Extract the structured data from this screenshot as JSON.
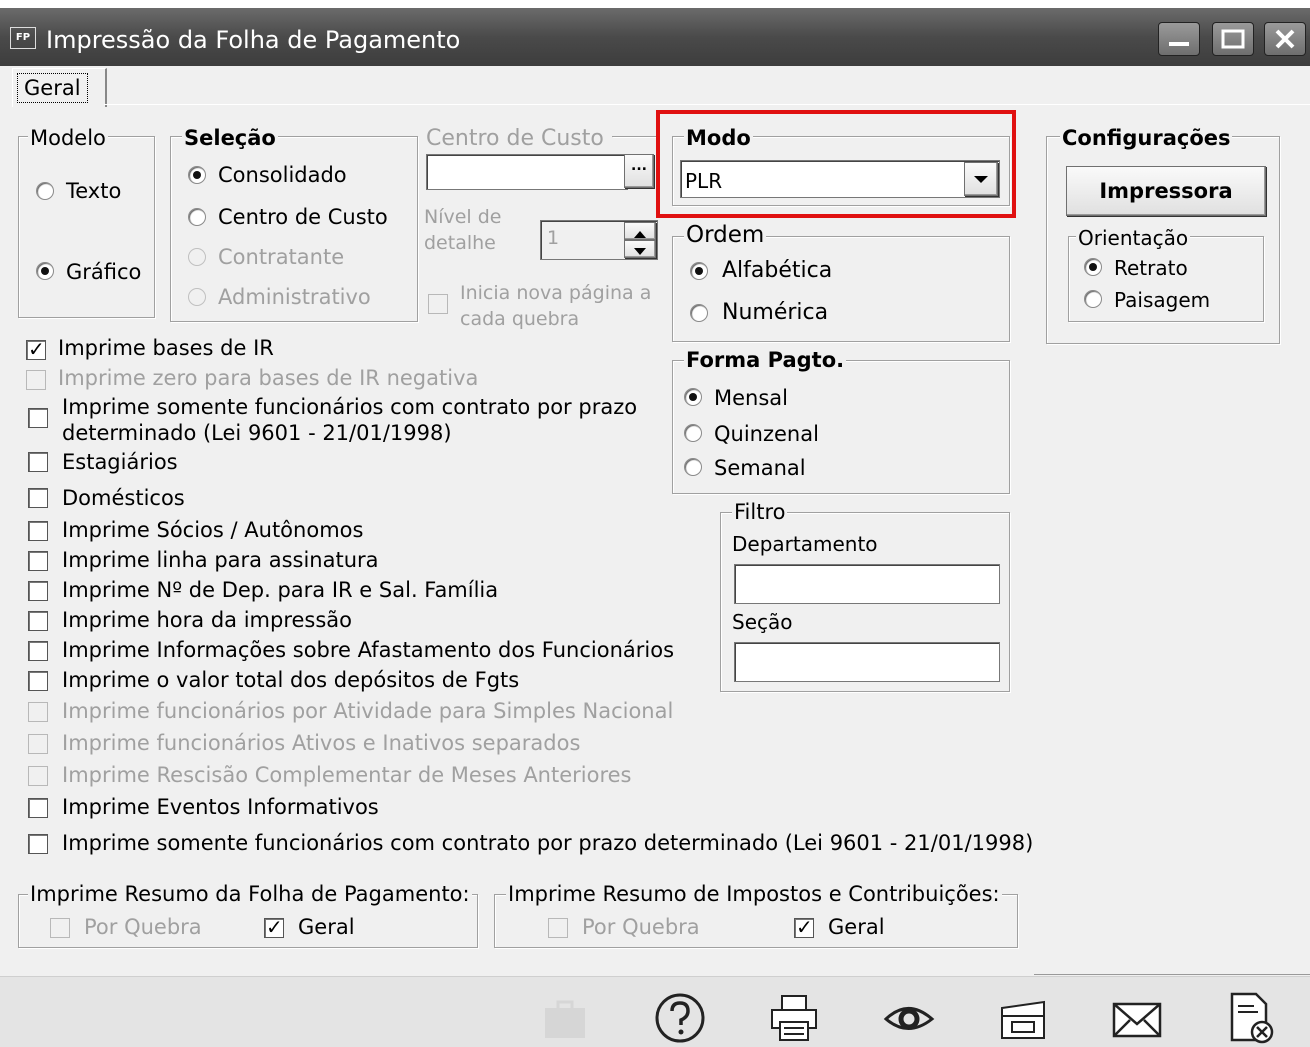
{
  "window": {
    "icon_text": "FP",
    "title": "Impressão da Folha de Pagamento"
  },
  "tab": {
    "label": "Geral"
  },
  "modelo": {
    "legend": "Modelo",
    "options": [
      "Texto",
      "Gráfico"
    ],
    "selected": "Gráfico"
  },
  "selecao": {
    "legend": "Seleção",
    "options": [
      "Consolidado",
      "Centro de Custo",
      "Contratante",
      "Administrativo"
    ],
    "selected": "Consolidado"
  },
  "centro_custo": {
    "legend": "Centro de Custo",
    "browse_label": "...",
    "detail_label_1": "Nível de",
    "detail_label_2": "detalhe",
    "detail_value": "1",
    "new_page_label_1": "Inicia nova página a",
    "new_page_label_2": "cada quebra"
  },
  "modo": {
    "legend": "Modo",
    "value": "PLR"
  },
  "ordem": {
    "legend": "Ordem",
    "options": [
      "Alfabética",
      "Numérica"
    ],
    "selected": "Alfabética"
  },
  "forma_pagto": {
    "legend": "Forma Pagto.",
    "options": [
      "Mensal",
      "Quinzenal",
      "Semanal"
    ],
    "selected": "Mensal"
  },
  "configuracoes": {
    "legend": "Configurações",
    "printer_button": "Impressora",
    "orientacao_legend": "Orientação",
    "orientacao_options": [
      "Retrato",
      "Paisagem"
    ],
    "selected": "Retrato"
  },
  "filtro": {
    "legend": "Filtro",
    "departamento_label": "Departamento",
    "departamento_value": "",
    "secao_label": "Seção",
    "secao_value": ""
  },
  "options": [
    {
      "label": "Imprime bases de IR",
      "checked": true,
      "enabled": true
    },
    {
      "label": "Imprime zero para bases de IR negativa",
      "checked": false,
      "enabled": false
    },
    {
      "label": "Imprime somente funcionários com contrato por prazo",
      "label2": "determinado (Lei 9601 - 21/01/1998)",
      "checked": false,
      "enabled": true
    },
    {
      "label": "Estagiários",
      "checked": false,
      "enabled": true
    },
    {
      "label": "Domésticos",
      "checked": false,
      "enabled": true
    },
    {
      "label": "Imprime Sócios / Autônomos",
      "checked": false,
      "enabled": true
    },
    {
      "label": "Imprime linha para assinatura",
      "checked": false,
      "enabled": true
    },
    {
      "label": "Imprime Nº de Dep. para IR e Sal. Família",
      "checked": false,
      "enabled": true
    },
    {
      "label": "Imprime hora da impressão",
      "checked": false,
      "enabled": true
    },
    {
      "label": "Imprime Informações sobre Afastamento dos Funcionários",
      "checked": false,
      "enabled": true
    },
    {
      "label": "Imprime o valor total dos depósitos de Fgts",
      "checked": false,
      "enabled": true
    },
    {
      "label": "Imprime funcionários por Atividade para Simples Nacional",
      "checked": false,
      "enabled": false
    },
    {
      "label": "Imprime funcionários Ativos e Inativos separados",
      "checked": false,
      "enabled": false
    },
    {
      "label": "Imprime Rescisão Complementar de Meses Anteriores",
      "checked": false,
      "enabled": false
    },
    {
      "label": "Imprime Eventos Informativos",
      "checked": false,
      "enabled": true
    },
    {
      "label": "Imprime somente funcionários com contrato por prazo determinado (Lei 9601 - 21/01/1998)",
      "checked": false,
      "enabled": true
    }
  ],
  "resumo_folha": {
    "legend": "Imprime Resumo da Folha de Pagamento:",
    "por_quebra": "Por Quebra",
    "geral": "Geral",
    "geral_checked": true
  },
  "resumo_impostos": {
    "legend": "Imprime Resumo de Impostos e Contribuições:",
    "por_quebra": "Por Quebra",
    "geral": "Geral",
    "geral_checked": true
  },
  "toolbar": {
    "icons": [
      "briefcase-icon",
      "help-icon",
      "printer-icon",
      "preview-eye-icon",
      "export-icon",
      "email-icon",
      "close-document-icon"
    ]
  }
}
